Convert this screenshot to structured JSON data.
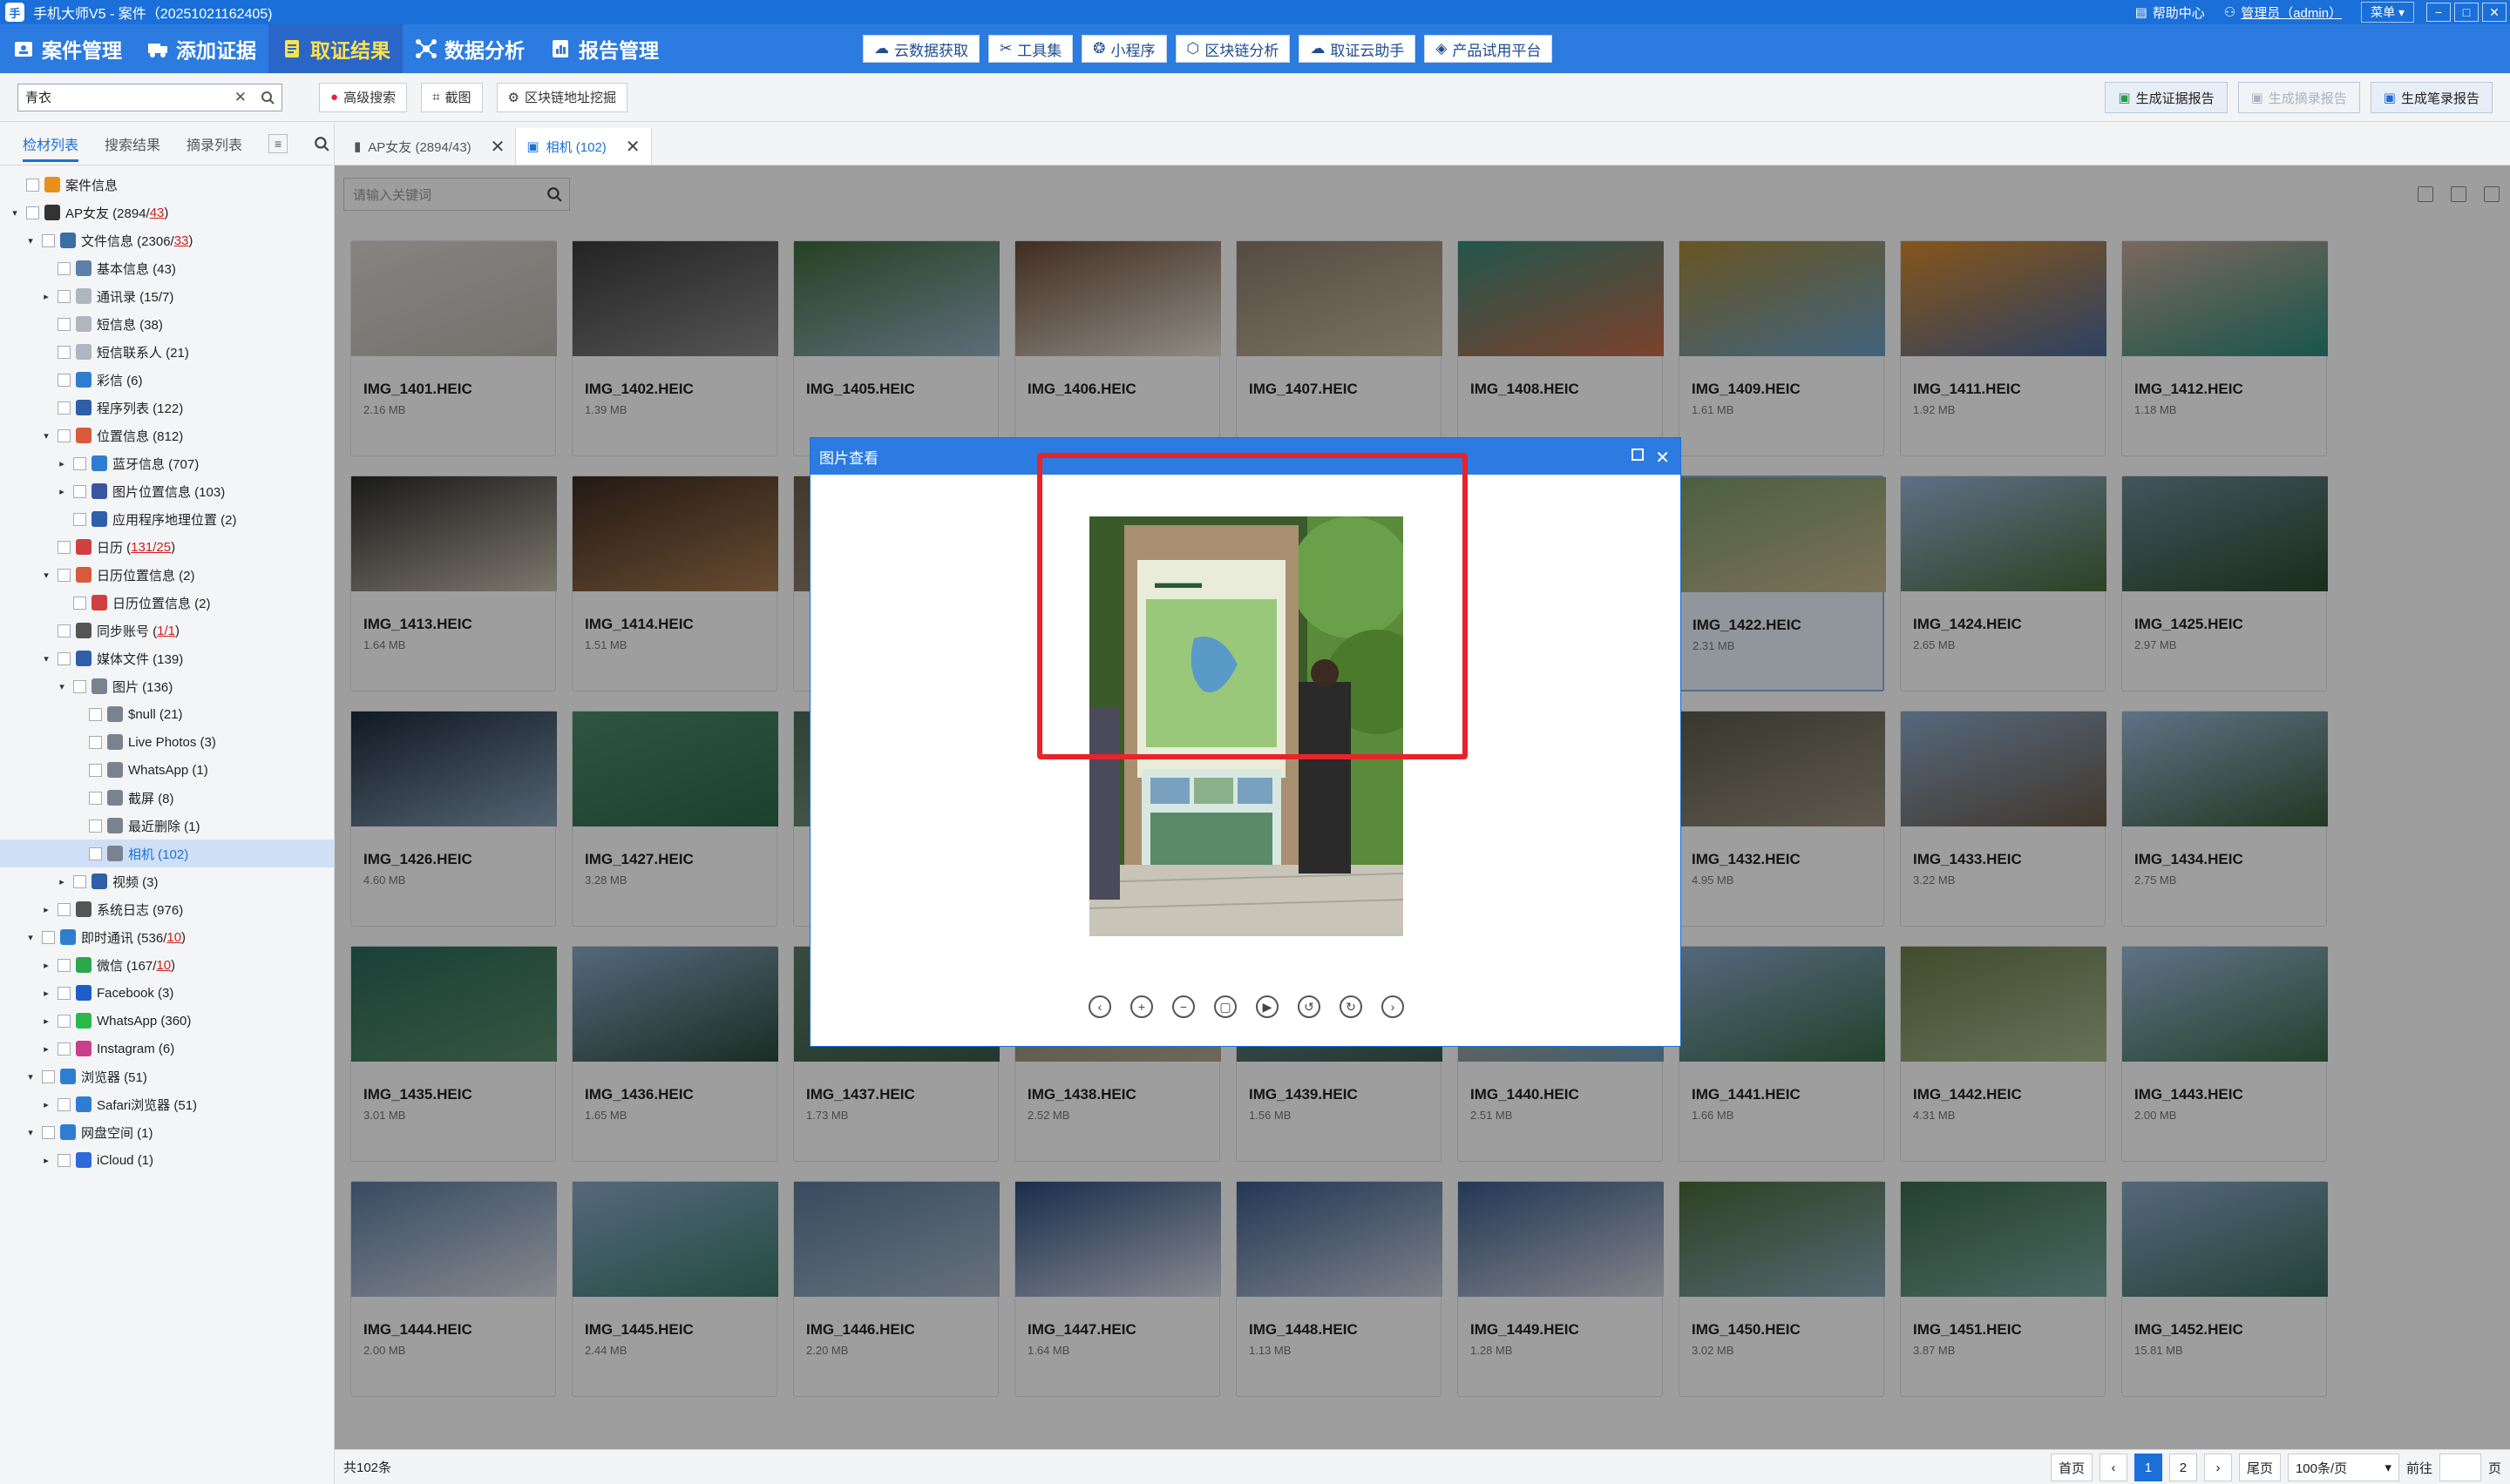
{
  "window": {
    "title": "手机大师V5 - 案件（20251021162405)",
    "help": "帮助中心",
    "user": "管理员（admin）",
    "menu": "菜单 ▾"
  },
  "menu": [
    {
      "label": "案件管理"
    },
    {
      "label": "添加证据"
    },
    {
      "label": "取证结果"
    },
    {
      "label": "数据分析"
    },
    {
      "label": "报告管理"
    }
  ],
  "tools": [
    "云数据获取",
    "工具集",
    "小程序",
    "区块链分析",
    "取证云助手",
    "产品试用平台"
  ],
  "toolbar": {
    "search_value": "青衣",
    "adv_search": "高级搜索",
    "screenshot": "截图",
    "blockchain": "区块链地址挖掘",
    "gen_report": "生成证据报告",
    "gen_excerpt": "生成摘录报告",
    "gen_notes": "生成笔录报告"
  },
  "side_tabs": [
    "检材列表",
    "搜索结果",
    "摘录列表"
  ],
  "tree": [
    {
      "l": "案件信息",
      "d": 0,
      "a": "",
      "c": "#e8901a"
    },
    {
      "l": "AP女友 (2894/",
      "r": "43",
      "t": ")",
      "d": 0,
      "a": "▾",
      "c": "#333"
    },
    {
      "l": "文件信息 (2306/",
      "r": "33",
      "t": ")",
      "d": 1,
      "a": "▾",
      "c": "#3a6ea5"
    },
    {
      "l": "基本信息 (43)",
      "d": 2,
      "a": "",
      "c": "#5b7fa8"
    },
    {
      "l": "通讯录 (15/7)",
      "d": 2,
      "a": "▸",
      "c": "#b0b6be"
    },
    {
      "l": "短信息 (38)",
      "d": 2,
      "a": "",
      "c": "#b0b6be"
    },
    {
      "l": "短信联系人 (21)",
      "d": 2,
      "a": "",
      "c": "#b0b6be"
    },
    {
      "l": "彩信 (6)",
      "d": 2,
      "a": "",
      "c": "#2e7dd1"
    },
    {
      "l": "程序列表 (122)",
      "d": 2,
      "a": "",
      "c": "#2e5fa8"
    },
    {
      "l": "位置信息 (812)",
      "d": 2,
      "a": "▾",
      "c": "#d85a3a"
    },
    {
      "l": "蓝牙信息 (707)",
      "d": 3,
      "a": "▸",
      "c": "#2e7dd1"
    },
    {
      "l": "图片位置信息 (103)",
      "d": 3,
      "a": "▸",
      "c": "#3a55a0"
    },
    {
      "l": "应用程序地理位置 (2)",
      "d": 3,
      "a": "",
      "c": "#2e5fa8"
    },
    {
      "l": "日历 (",
      "r": "131/25",
      "t": ")",
      "d": 2,
      "a": "",
      "c": "#d04040"
    },
    {
      "l": "日历位置信息 (2)",
      "d": 2,
      "a": "▾",
      "c": "#d85a3a"
    },
    {
      "l": "日历位置信息 (2)",
      "d": 3,
      "a": "",
      "c": "#d04040"
    },
    {
      "l": "同步账号 (",
      "r": "1/1",
      "t": ")",
      "d": 2,
      "a": "",
      "c": "#555"
    },
    {
      "l": "媒体文件 (139)",
      "d": 2,
      "a": "▾",
      "c": "#2e5fa8"
    },
    {
      "l": "图片 (136)",
      "d": 3,
      "a": "▾",
      "c": "#7a8290"
    },
    {
      "l": "$null (21)",
      "d": 4,
      "a": "",
      "c": "#7a8290"
    },
    {
      "l": "Live Photos (3)",
      "d": 4,
      "a": "",
      "c": "#7a8290"
    },
    {
      "l": "WhatsApp (1)",
      "d": 4,
      "a": "",
      "c": "#7a8290"
    },
    {
      "l": "截屏 (8)",
      "d": 4,
      "a": "",
      "c": "#7a8290"
    },
    {
      "l": "最近删除 (1)",
      "d": 4,
      "a": "",
      "c": "#7a8290"
    },
    {
      "l": "相机 (102)",
      "d": 4,
      "a": "",
      "c": "#7a8290",
      "sel": true
    },
    {
      "l": "视频 (3)",
      "d": 3,
      "a": "▸",
      "c": "#2e5fa8"
    },
    {
      "l": "系统日志 (976)",
      "d": 2,
      "a": "▸",
      "c": "#555"
    },
    {
      "l": "即时通讯 (536/",
      "r": "10",
      "t": ")",
      "d": 1,
      "a": "▾",
      "c": "#2e7dd1"
    },
    {
      "l": "微信 (167/",
      "r": "10",
      "t": ")",
      "d": 2,
      "a": "▸",
      "c": "#2aa84a"
    },
    {
      "l": "Facebook (3)",
      "d": 2,
      "a": "▸",
      "c": "#1b5ec7"
    },
    {
      "l": "WhatsApp (360)",
      "d": 2,
      "a": "▸",
      "c": "#2ab84a"
    },
    {
      "l": "Instagram (6)",
      "d": 2,
      "a": "▸",
      "c": "#c8408a"
    },
    {
      "l": "浏览器 (51)",
      "d": 1,
      "a": "▾",
      "c": "#2e7dd1"
    },
    {
      "l": "Safari浏览器 (51)",
      "d": 2,
      "a": "▸",
      "c": "#2e7dd1"
    },
    {
      "l": "网盘空间 (1)",
      "d": 1,
      "a": "▾",
      "c": "#2e7dd1"
    },
    {
      "l": "iCloud (1)",
      "d": 2,
      "a": "▸",
      "c": "#2e6ad8"
    }
  ],
  "panel_tabs": [
    {
      "label": "AP女友 (2894/43)"
    },
    {
      "label": "相机 (102)"
    }
  ],
  "keyword_placeholder": "请输入关键词",
  "photos": [
    {
      "n": "IMG_1401.HEIC",
      "s": "2.16 MB",
      "c": [
        "#d8d5d0",
        "#bbb7b0"
      ]
    },
    {
      "n": "IMG_1402.HEIC",
      "s": "1.39 MB",
      "c": [
        "#3a3a3a",
        "#8a8a8a"
      ]
    },
    {
      "n": "IMG_1405.HEIC",
      "s": "",
      "c": [
        "#3d6b3a",
        "#9ab0c4"
      ]
    },
    {
      "n": "IMG_1406.HEIC",
      "s": "",
      "c": [
        "#6a4a36",
        "#e6e0d4"
      ]
    },
    {
      "n": "IMG_1407.HEIC",
      "s": "",
      "c": [
        "#8a7a6a",
        "#c8b8a0"
      ]
    },
    {
      "n": "IMG_1408.HEIC",
      "s": "",
      "c": [
        "#3a8a7a",
        "#c86a4a"
      ]
    },
    {
      "n": "IMG_1409.HEIC",
      "s": "1.61 MB",
      "c": [
        "#a88a3a",
        "#6aa0c8"
      ]
    },
    {
      "n": "IMG_1411.HEIC",
      "s": "1.92 MB",
      "c": [
        "#d88a2a",
        "#4a6aa0"
      ]
    },
    {
      "n": "IMG_1412.HEIC",
      "s": "1.18 MB",
      "c": [
        "#c8a898",
        "#2a8a7a"
      ]
    },
    {
      "n": "IMG_1413.HEIC",
      "s": "1.64 MB",
      "c": [
        "#2a2a2a",
        "#c8c0b0"
      ]
    },
    {
      "n": "IMG_1414.HEIC",
      "s": "1.51 MB",
      "c": [
        "#3a2a20",
        "#a87a50"
      ]
    },
    {
      "n": "",
      "s": "",
      "c": [
        "#6a5a4a",
        "#9a8a7a"
      ]
    },
    {
      "n": "",
      "s": "",
      "c": [
        "#6a5a4a",
        "#9a8a7a"
      ]
    },
    {
      "n": "",
      "s": "",
      "c": [
        "#6a5a4a",
        "#9a8a7a"
      ]
    },
    {
      "n": "",
      "s": "",
      "c": [
        "#6a5a4a",
        "#9a8a7a"
      ]
    },
    {
      "n": "IMG_1422.HEIC",
      "s": "2.31 MB",
      "c": [
        "#7a9a6a",
        "#c8b890"
      ]
    },
    {
      "n": "IMG_1424.HEIC",
      "s": "2.65 MB",
      "c": [
        "#9ab4d8",
        "#4a6a3a"
      ]
    },
    {
      "n": "IMG_1425.HEIC",
      "s": "2.97 MB",
      "c": [
        "#6a8a9a",
        "#2a4a2a"
      ]
    },
    {
      "n": "IMG_1426.HEIC",
      "s": "4.60 MB",
      "c": [
        "#1a2a3a",
        "#8aa0b8"
      ]
    },
    {
      "n": "IMG_1427.HEIC",
      "s": "3.28 MB",
      "c": [
        "#4a8a6a",
        "#2a6a4a"
      ]
    },
    {
      "n": "",
      "s": "",
      "c": [
        "#4a6a5a",
        "#7a9a8a"
      ]
    },
    {
      "n": "",
      "s": "",
      "c": [
        "#4a6a5a",
        "#7a9a8a"
      ]
    },
    {
      "n": "",
      "s": "",
      "c": [
        "#4a6a5a",
        "#7a9a8a"
      ]
    },
    {
      "n": "",
      "s": "",
      "c": [
        "#4a6a5a",
        "#7a9a8a"
      ]
    },
    {
      "n": "IMG_1432.HEIC",
      "s": "4.95 MB",
      "c": [
        "#5a5a4a",
        "#9a9080"
      ]
    },
    {
      "n": "IMG_1433.HEIC",
      "s": "3.22 MB",
      "c": [
        "#8aa8c8",
        "#6a5a4a"
      ]
    },
    {
      "n": "IMG_1434.HEIC",
      "s": "2.75 MB",
      "c": [
        "#9ab8d8",
        "#3a5a3a"
      ]
    },
    {
      "n": "IMG_1435.HEIC",
      "s": "3.01 MB",
      "c": [
        "#2a6a5a",
        "#5a8a6a"
      ]
    },
    {
      "n": "IMG_1436.HEIC",
      "s": "1.65 MB",
      "c": [
        "#8aa8c8",
        "#2a4a3a"
      ]
    },
    {
      "n": "IMG_1437.HEIC",
      "s": "1.73 MB",
      "c": [
        "#5a7a6a",
        "#3a5a4a"
      ]
    },
    {
      "n": "IMG_1438.HEIC",
      "s": "2.52 MB",
      "c": [
        "#8a8070",
        "#b0a890"
      ]
    },
    {
      "n": "IMG_1439.HEIC",
      "s": "1.56 MB",
      "c": [
        "#6a8aa0",
        "#3a5a4a"
      ]
    },
    {
      "n": "IMG_1440.HEIC",
      "s": "2.51 MB",
      "c": [
        "#c8a878",
        "#6a9ab8"
      ]
    },
    {
      "n": "IMG_1441.HEIC",
      "s": "1.66 MB",
      "c": [
        "#8aa8c8",
        "#3a6a4a"
      ]
    },
    {
      "n": "IMG_1442.HEIC",
      "s": "4.31 MB",
      "c": [
        "#6a7a4a",
        "#a8b890"
      ]
    },
    {
      "n": "IMG_1443.HEIC",
      "s": "2.00 MB",
      "c": [
        "#9ab8d8",
        "#3a6a4a"
      ]
    },
    {
      "n": "IMG_1444.HEIC",
      "s": "2.00 MB",
      "c": [
        "#5a7aa0",
        "#d8dce4"
      ]
    },
    {
      "n": "IMG_1445.HEIC",
      "s": "2.44 MB",
      "c": [
        "#8aa8c8",
        "#3a7a6a"
      ]
    },
    {
      "n": "IMG_1446.HEIC",
      "s": "2.20 MB",
      "c": [
        "#5a7a9a",
        "#a8b8c8"
      ]
    },
    {
      "n": "IMG_1447.HEIC",
      "s": "1.64 MB",
      "c": [
        "#2a4a7a",
        "#d8dce8"
      ]
    },
    {
      "n": "IMG_1448.HEIC",
      "s": "1.13 MB",
      "c": [
        "#3a5a8a",
        "#c8d0dc"
      ]
    },
    {
      "n": "IMG_1449.HEIC",
      "s": "1.28 MB",
      "c": [
        "#3a5a8a",
        "#d0d4dc"
      ]
    },
    {
      "n": "IMG_1450.HEIC",
      "s": "3.02 MB",
      "c": [
        "#4a6a3a",
        "#8aa8b8"
      ]
    },
    {
      "n": "IMG_1451.HEIC",
      "s": "3.87 MB",
      "c": [
        "#3a6a4a",
        "#7aa8a0"
      ]
    },
    {
      "n": "IMG_1452.HEIC",
      "s": "15.81 MB",
      "c": [
        "#8aa8c8",
        "#3a6a5a"
      ]
    }
  ],
  "footer": {
    "total": "共102条",
    "first": "首页",
    "prev": "‹",
    "page1": "1",
    "page2": "2",
    "next": "›",
    "last": "尾页",
    "per_page": "100条/页",
    "goto": "前往",
    "page_unit": "页"
  },
  "viewer": {
    "title": "图片查看"
  }
}
